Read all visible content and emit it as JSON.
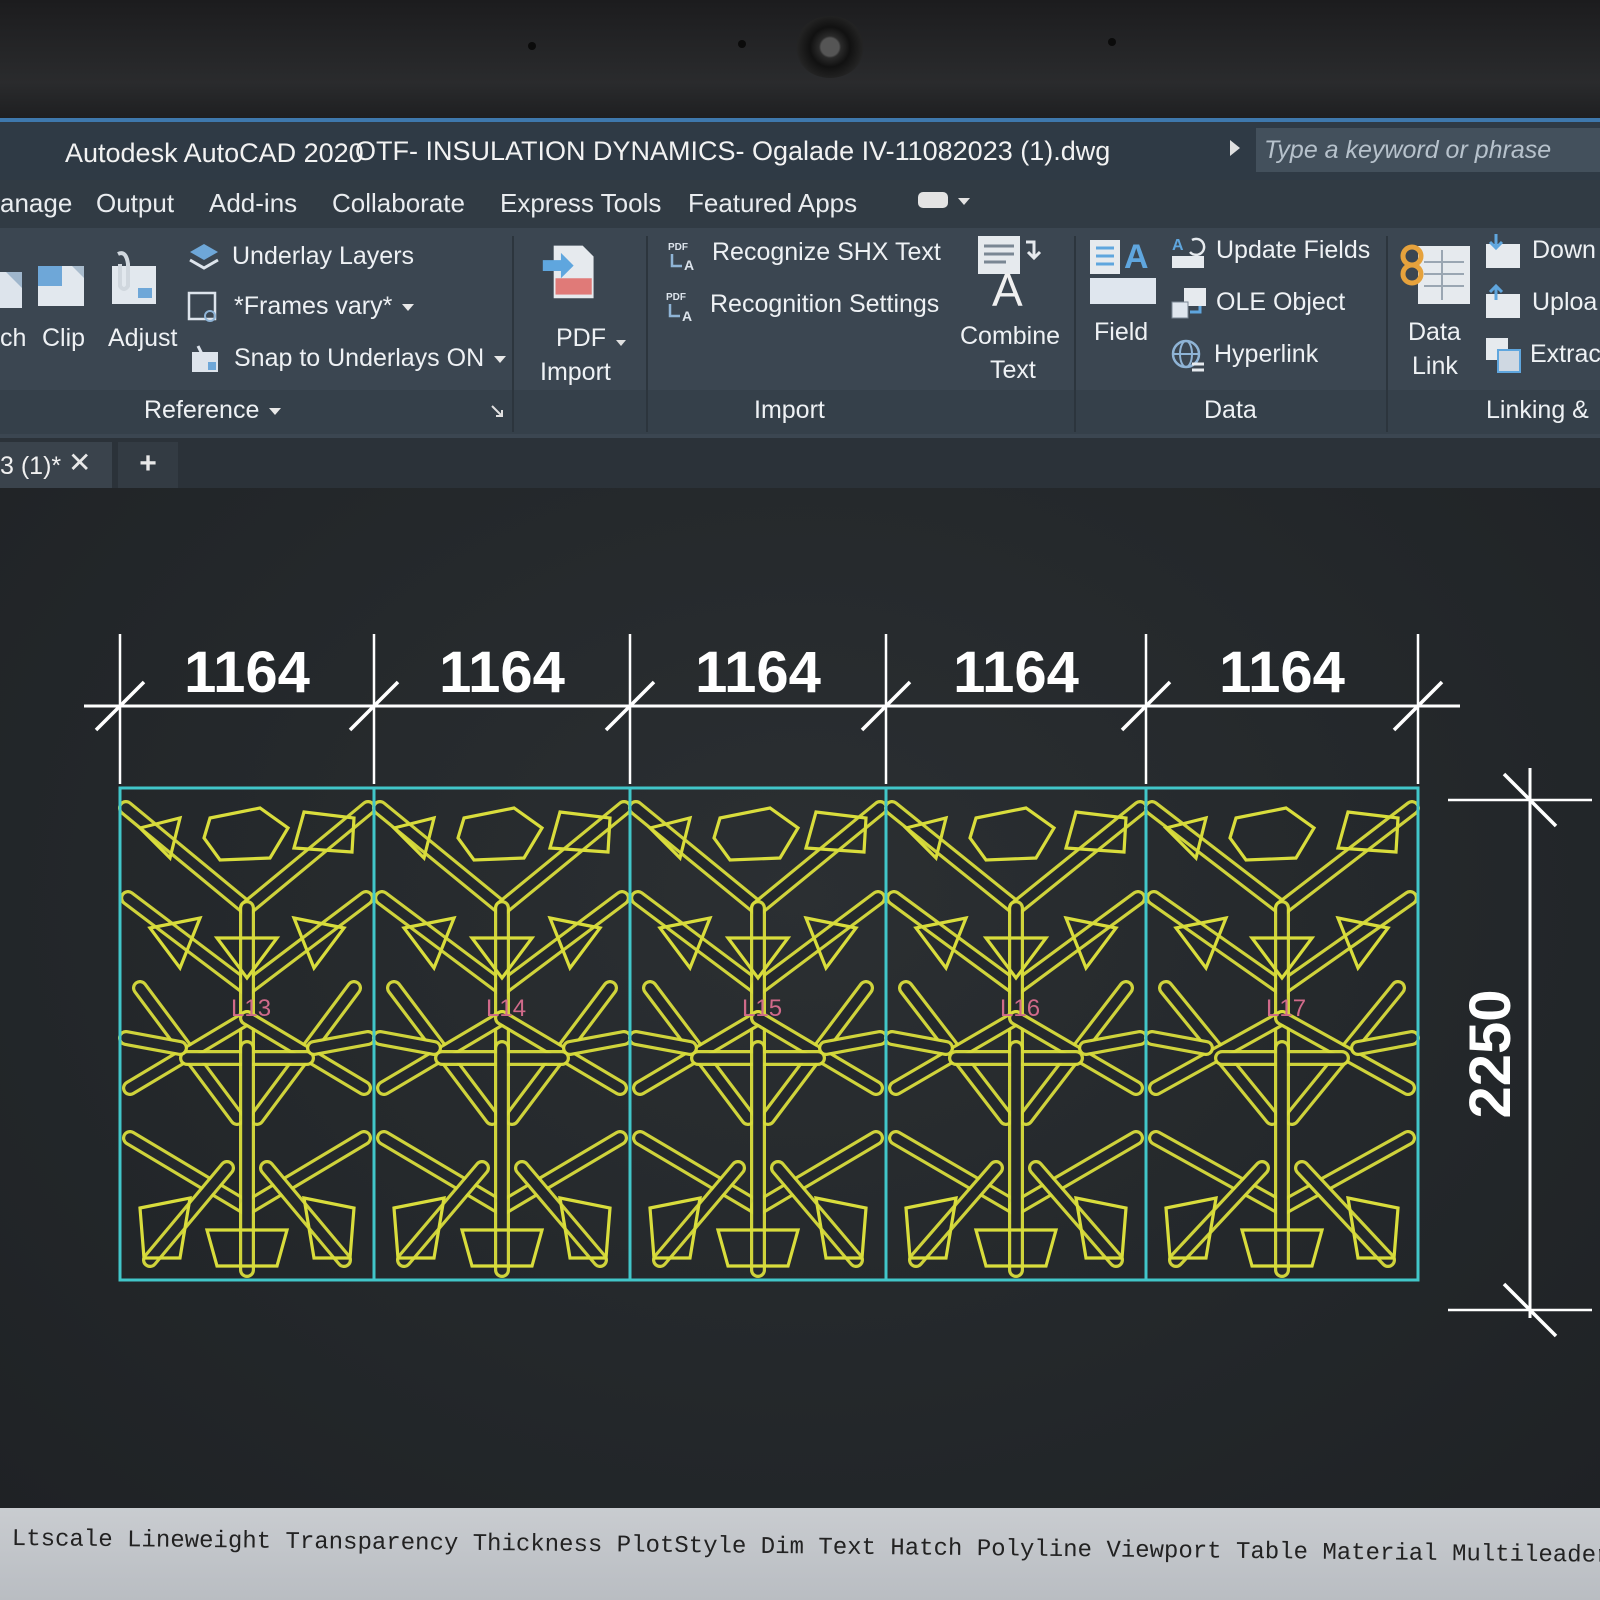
{
  "window": {
    "app_title": "Autodesk AutoCAD 2020",
    "doc_title": "OTF- INSULATION DYNAMICS- Ogalade IV-11082023 (1).dwg",
    "search_placeholder": "Type a keyword or phrase"
  },
  "ribbon_tabs": [
    "anage",
    "Output",
    "Add-ins",
    "Collaborate",
    "Express Tools",
    "Featured Apps"
  ],
  "reference_panel": {
    "title": "Reference",
    "buttons": [
      "ch",
      "Clip",
      "Adjust"
    ],
    "underlay_layers": "Underlay Layers",
    "frames": "*Frames vary*",
    "snap": "Snap to Underlays ON"
  },
  "import_panel": {
    "title": "Import",
    "pdf_import": [
      "PDF",
      "Import"
    ],
    "recognize_shx": "Recognize SHX Text",
    "recognition_settings": "Recognition Settings",
    "combine_text": [
      "Combine",
      "Text"
    ]
  },
  "data_panel": {
    "title": "Data",
    "field": "Field",
    "update_fields": "Update Fields",
    "ole_object": "OLE Object",
    "hyperlink": "Hyperlink"
  },
  "linking_panel": {
    "title": "Linking &",
    "data_link": [
      "Data",
      "Link"
    ],
    "download": "Down",
    "upload": "Uploa",
    "extract": "Extrac"
  },
  "document_tab": {
    "label": "3 (1)*",
    "close": "✕",
    "new": "+"
  },
  "drawing": {
    "dimensions_top": [
      "1164",
      "1164",
      "1164",
      "1164",
      "1164"
    ],
    "dimension_right": "2250",
    "panel_tags": [
      "L13",
      "L14",
      "L15",
      "L16",
      "L17"
    ],
    "line_color": "#d9dd3c",
    "frame_color": "#41c6c9",
    "dim_color": "#ffffff"
  },
  "command_bar": {
    "text": "Ltscale Lineweight Transparency Thickness PlotStyle Dim Text Hatch Polyline Viewport Table Material Multileader"
  }
}
